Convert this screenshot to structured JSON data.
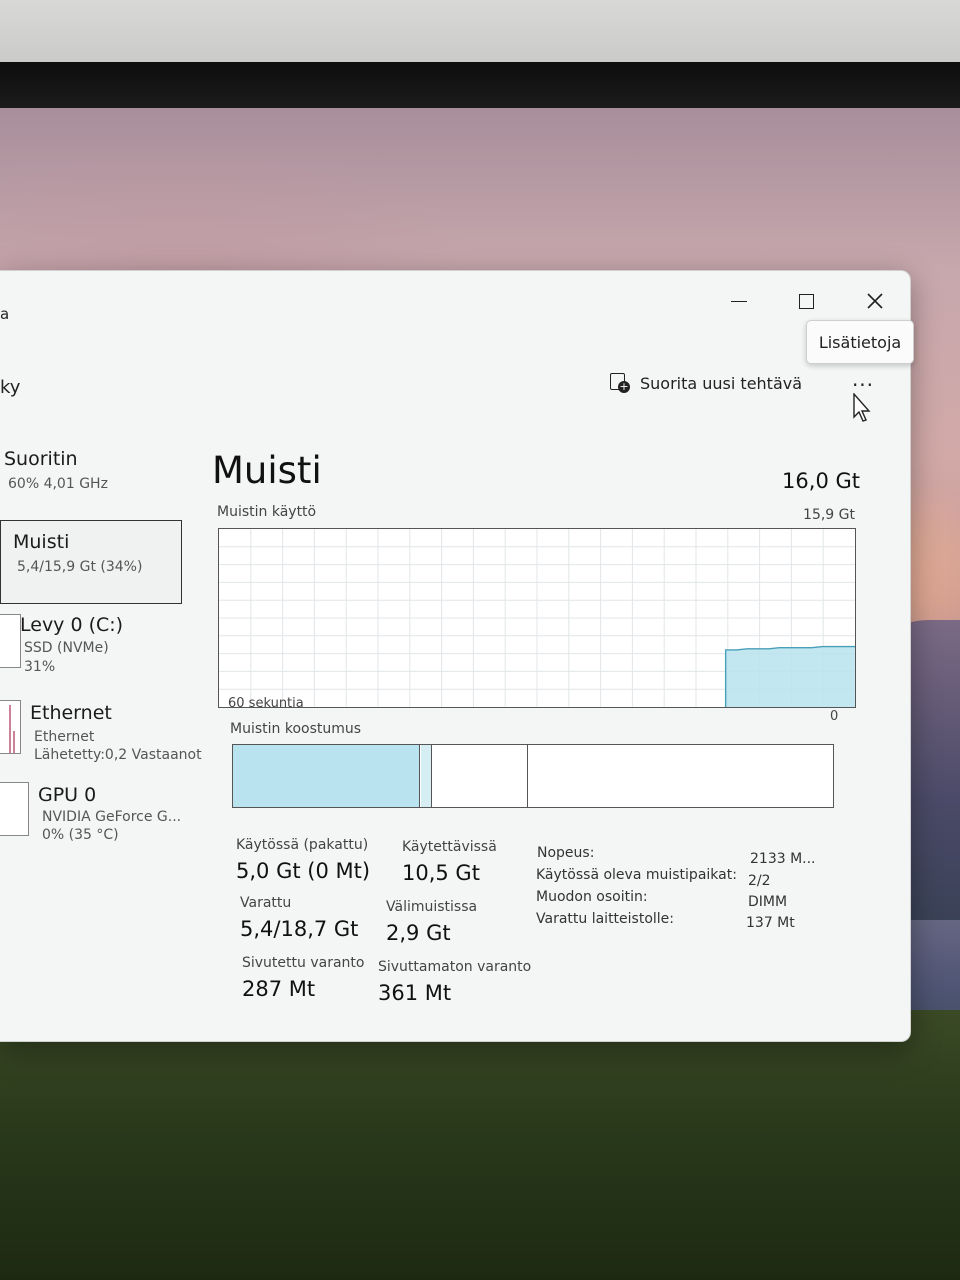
{
  "window": {
    "title_partial": "a",
    "page_partial": "ky",
    "tooltip": "Lisätietoja",
    "run_task_label": "Suorita uusi tehtävä",
    "more_label": "..."
  },
  "sidebar": {
    "items": [
      {
        "title": "Suoritin",
        "sub1": "60% 4,01 GHz"
      },
      {
        "title": "Muisti",
        "sub1": "5,4/15,9 Gt (34%)"
      },
      {
        "title": "Levy 0 (C:)",
        "sub1": "SSD (NVMe)",
        "sub2": "31%"
      },
      {
        "title": "Ethernet",
        "sub1": "Ethernet",
        "sub2": "Lähetetty:0,2 Vastaanot"
      },
      {
        "title": "GPU 0",
        "sub1": "NVIDIA GeForce G...",
        "sub2": "0% (35 °C)"
      }
    ]
  },
  "memory": {
    "title": "Muisti",
    "total": "16,0 Gt",
    "usage_label": "Muistin käyttö",
    "usage_max": "15,9 Gt",
    "time_label": "60 sekuntia",
    "zero_label": "0",
    "composition_label": "Muistin koostumus",
    "usage_history_gb": [
      0,
      0,
      0,
      0,
      0,
      0,
      0,
      0,
      0,
      0,
      0,
      0,
      0,
      0,
      0,
      0,
      0,
      0,
      0,
      0,
      0,
      0,
      0,
      0,
      0,
      0,
      0,
      0,
      0,
      0,
      0,
      0,
      0,
      0,
      0,
      0,
      0,
      0,
      0,
      0,
      0,
      0,
      0,
      0,
      0,
      0,
      0,
      5.1,
      5.1,
      5.2,
      5.2,
      5.2,
      5.3,
      5.3,
      5.3,
      5.3,
      5.4,
      5.4,
      5.4,
      5.4
    ],
    "usage_max_gb": 15.9,
    "stats": {
      "in_use_label": "Käytössä (pakattu)",
      "in_use_value": "5,0 Gt (0 Mt)",
      "available_label": "Käytettävissä",
      "available_value": "10,5 Gt",
      "committed_label": "Varattu",
      "committed_value": "5,4/18,7 Gt",
      "cached_label": "Välimuistissa",
      "cached_value": "2,9 Gt",
      "paged_label": "Sivutettu varanto",
      "paged_value": "287 Mt",
      "nonpaged_label": "Sivuttamaton varanto",
      "nonpaged_value": "361 Mt"
    },
    "details": [
      {
        "key": "Nopeus:",
        "value": "2133 M..."
      },
      {
        "key": "Käytössä oleva muistipaikat:",
        "value": "2/2"
      },
      {
        "key": "Muodon osoitin:",
        "value": "DIMM"
      },
      {
        "key": "Varattu laitteistolle:",
        "value": "137 Mt"
      }
    ]
  },
  "colors": {
    "accent_fill": "#b9e3ef",
    "accent_line": "#4a9fb8",
    "window_bg": "#f4f6f5"
  }
}
